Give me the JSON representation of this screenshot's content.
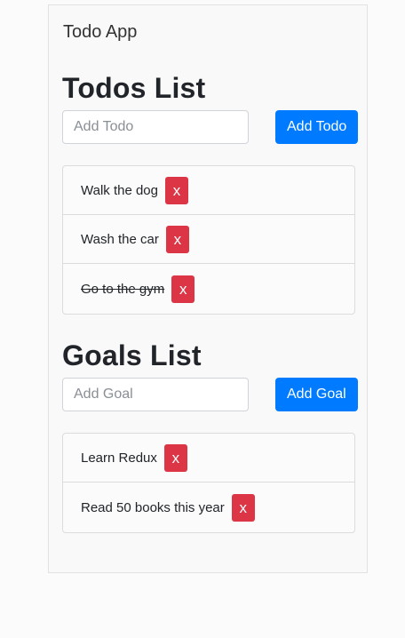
{
  "app": {
    "brand": "Todo App"
  },
  "todos": {
    "title": "Todos List",
    "input_placeholder": "Add Todo",
    "input_value": "",
    "add_label": "Add Todo",
    "items": [
      {
        "text": "Walk the dog",
        "complete": false,
        "remove_label": "x"
      },
      {
        "text": "Wash the car",
        "complete": false,
        "remove_label": "x"
      },
      {
        "text": "Go to the gym",
        "complete": true,
        "remove_label": "x"
      }
    ]
  },
  "goals": {
    "title": "Goals List",
    "input_placeholder": "Add Goal",
    "input_value": "",
    "add_label": "Add Goal",
    "items": [
      {
        "text": "Learn Redux",
        "remove_label": "x"
      },
      {
        "text": "Read 50 books this year",
        "remove_label": "x"
      }
    ]
  },
  "colors": {
    "primary": "#007bff",
    "danger": "#dc3545",
    "border": "#dcdcdc"
  }
}
